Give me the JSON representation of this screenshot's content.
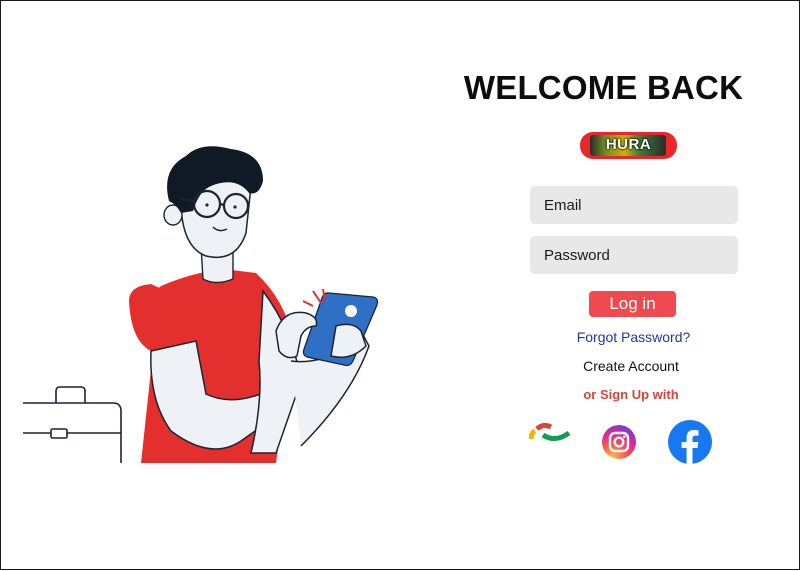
{
  "header": {
    "title": "WELCOME BACK"
  },
  "logo": {
    "text": "HURA"
  },
  "form": {
    "email_placeholder": "Email",
    "password_placeholder": "Password",
    "login_label": "Log in",
    "forgot_label": "Forgot Password?",
    "create_label": "Create Account",
    "signup_with_label": "or Sign Up with"
  },
  "social": [
    {
      "icon": "google-icon"
    },
    {
      "icon": "instagram-icon"
    },
    {
      "icon": "facebook-icon"
    }
  ],
  "colors": {
    "accent": "#f0494f",
    "field_bg": "#e8e8e8",
    "link_blue": "#1e3a9e",
    "signup_red": "#d7443b",
    "shirt_red": "#e42f2f",
    "phone_blue": "#2f6fc4",
    "outline": "#1c2433"
  }
}
